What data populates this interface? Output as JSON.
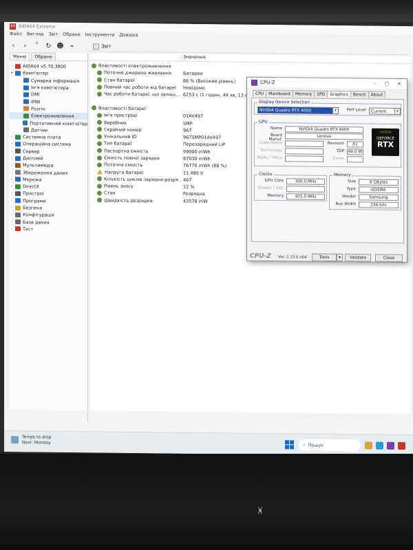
{
  "aida": {
    "title": "AIDA64 Extreme",
    "badge": "64",
    "menu": [
      "Файл",
      "Вигляд",
      "Звіт",
      "Обране",
      "Інструменти",
      "Довідка"
    ],
    "report_label": "Звіт",
    "pane_tabs": [
      "Меню",
      "Обране"
    ],
    "tree": [
      {
        "label": "AIDA64 v5.70.3800",
        "level": 0,
        "expand": "",
        "color": "#c0392b"
      },
      {
        "label": "Комп'ютер",
        "level": 0,
        "expand": "▾",
        "color": "#2f6db3"
      },
      {
        "label": "Сумарна інформація",
        "level": 2,
        "expand": "",
        "color": "#2f6db3"
      },
      {
        "label": "Ім'я комп'ютера",
        "level": 2,
        "expand": "",
        "color": "#2f6db3"
      },
      {
        "label": "DMI",
        "level": 2,
        "expand": "",
        "color": "#2f6db3"
      },
      {
        "label": "IPMI",
        "level": 2,
        "expand": "",
        "color": "#2f6db3"
      },
      {
        "label": "Розгін",
        "level": 2,
        "expand": "",
        "color": "#e07b24"
      },
      {
        "label": "Електроживлення",
        "level": 2,
        "expand": "",
        "color": "#3d8b3d",
        "selected": true
      },
      {
        "label": "Портативний комп'ютер",
        "level": 2,
        "expand": "",
        "color": "#2f6db3"
      },
      {
        "label": "Датчик",
        "level": 2,
        "expand": "",
        "color": "#6b6b6b"
      },
      {
        "label": "Системна плата",
        "level": 0,
        "expand": "›",
        "color": "#2e8b57"
      },
      {
        "label": "Операційна система",
        "level": 0,
        "expand": "›",
        "color": "#1f6fd1"
      },
      {
        "label": "Сервер",
        "level": 0,
        "expand": "›",
        "color": "#555"
      },
      {
        "label": "Дисплей",
        "level": 0,
        "expand": "›",
        "color": "#2f6db3"
      },
      {
        "label": "Мультимедіа",
        "level": 0,
        "expand": "›",
        "color": "#8a5a2b"
      },
      {
        "label": "Збереження даних",
        "level": 0,
        "expand": "›",
        "color": "#777"
      },
      {
        "label": "Мережа",
        "level": 0,
        "expand": "›",
        "color": "#2f6db3"
      },
      {
        "label": "DirectX",
        "level": 0,
        "expand": "›",
        "color": "#3d8b3d"
      },
      {
        "label": "Пристрої",
        "level": 0,
        "expand": "›",
        "color": "#555"
      },
      {
        "label": "Програми",
        "level": 0,
        "expand": "›",
        "color": "#1f6fd1"
      },
      {
        "label": "Безпека",
        "level": 0,
        "expand": "›",
        "color": "#c9a227"
      },
      {
        "label": "Конфігурація",
        "level": 0,
        "expand": "›",
        "color": "#666"
      },
      {
        "label": "База даних",
        "level": 0,
        "expand": "›",
        "color": "#666"
      },
      {
        "label": "Тест",
        "level": 0,
        "expand": "›",
        "color": "#c0392b"
      }
    ],
    "columns": {
      "field": "",
      "value": "Значення"
    },
    "rows": [
      {
        "field": "Властивості електроживлення",
        "value": "",
        "group": true
      },
      {
        "field": "Поточне джерело живлення",
        "value": "Батарея"
      },
      {
        "field": "Стан батареї",
        "value": "86 % (Високий рівень)"
      },
      {
        "field": "Повний час роботи від батареї",
        "value": "Невідомо"
      },
      {
        "field": "Час роботи батареї, що залиш...",
        "value": "6253 с (1 годин, 44 хв, 13 с)"
      },
      {
        "field": "",
        "value": "",
        "spacer": true
      },
      {
        "field": "Властивості батареї",
        "value": "",
        "group": true
      },
      {
        "field": "Ім'я пристрою",
        "value": "01AV497"
      },
      {
        "field": "Виробник",
        "value": "SMP"
      },
      {
        "field": "Серійний номер",
        "value": "967"
      },
      {
        "field": "Унікальний ID",
        "value": "967SMP01AV497"
      },
      {
        "field": "Тип батареї",
        "value": "Перезарядний LiP"
      },
      {
        "field": "Паспортна ємність",
        "value": "99000 mWh"
      },
      {
        "field": "Ємність повної зарядки",
        "value": "87030 mWh"
      },
      {
        "field": "Поточна ємність",
        "value": "76770 mWh  (88 %)"
      },
      {
        "field": "Напруга батареї",
        "value": "11.480 V",
        "warn": true
      },
      {
        "field": "Кількість циклів зарядки-розря...",
        "value": "467"
      },
      {
        "field": "Рівень зносу",
        "value": "12 %"
      },
      {
        "field": "Стан",
        "value": "Розрядка"
      },
      {
        "field": "Швидкість розрядки",
        "value": "43578 mW"
      }
    ]
  },
  "taskbar": {
    "weather_line1": "Temps to drop",
    "weather_line2": "Next: Monday",
    "search_placeholder": "Пошук"
  },
  "cpuz": {
    "title": "CPU-Z",
    "tabs": [
      "CPU",
      "Mainboard",
      "Memory",
      "SPD",
      "Graphics",
      "Bench",
      "About"
    ],
    "active_tab": "Graphics",
    "display_selection_label": "Display Device Selection",
    "device": "NVIDIA Quadro RTX 4000",
    "perf_level_label": "Perf Level",
    "perf_level": "Current",
    "gpu_label": "GPU",
    "name_label": "Name",
    "name": "NVIDIA Quadro RTX 4000",
    "board_manuf_label": "Board Manuf.",
    "board_manuf": "Lenovo",
    "code_name_label": "Code Name",
    "revision_label": "Revision",
    "revision": "A1",
    "technology_label": "Technology",
    "tdp_label": "TDP",
    "tdp": "90.0 W",
    "rops_label": "ROPs / TMUs",
    "cores_label": "Cores",
    "clocks_label": "Clocks",
    "gpu_core_label": "GPU Core",
    "gpu_core": "300.0 MHz",
    "shader_label": "Shader / SoC",
    "memory_clock_label": "Memory",
    "memory_clock": "405.0 MHz",
    "memory_label": "Memory",
    "size_label": "Size",
    "size": "8 GBytes",
    "type_label": "Type",
    "type": "GDDR6",
    "vendor_label": "Vendor",
    "vendor": "Samsung",
    "bus_width_label": "Bus Width",
    "bus_width": "256 bits",
    "logo_top": "nVIDIA",
    "logo_mid": "GEFORCE",
    "logo_bottom": "RTX",
    "brand": "CPU-Z",
    "version": "Ver. 2.15.0.x64",
    "tools_label": "Tools",
    "validate_label": "Validate",
    "close_label": "Close"
  }
}
